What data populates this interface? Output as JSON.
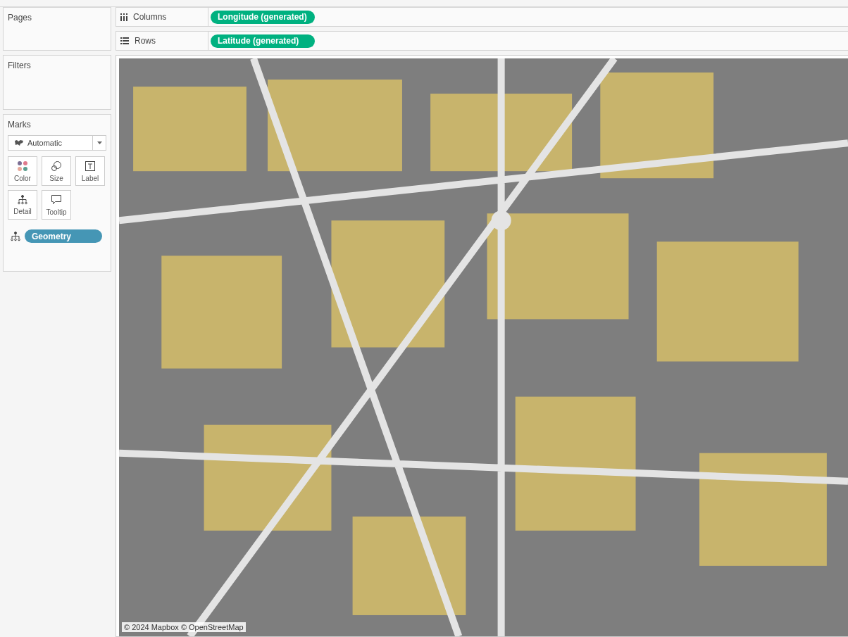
{
  "sidebar": {
    "pages": {
      "title": "Pages"
    },
    "filters": {
      "title": "Filters"
    },
    "marks": {
      "title": "Marks",
      "mark_type": "Automatic",
      "cards": [
        {
          "kind": "color",
          "label": "Color"
        },
        {
          "kind": "size",
          "label": "Size"
        },
        {
          "kind": "label",
          "label": "Label"
        },
        {
          "kind": "detail",
          "label": "Detail"
        },
        {
          "kind": "tooltip",
          "label": "Tooltip"
        }
      ],
      "fields": [
        {
          "kind": "detail",
          "label": "Geometry"
        }
      ]
    }
  },
  "shelves": [
    {
      "kind": "columns",
      "label": "Columns",
      "pills": [
        "Longitude (generated)"
      ]
    },
    {
      "kind": "rows",
      "label": "Rows",
      "pills": [
        "Latitude (generated)"
      ]
    }
  ],
  "map": {
    "kind": "picture",
    "attribution": "© 2024 Mapbox © OpenStreetMap"
  }
}
